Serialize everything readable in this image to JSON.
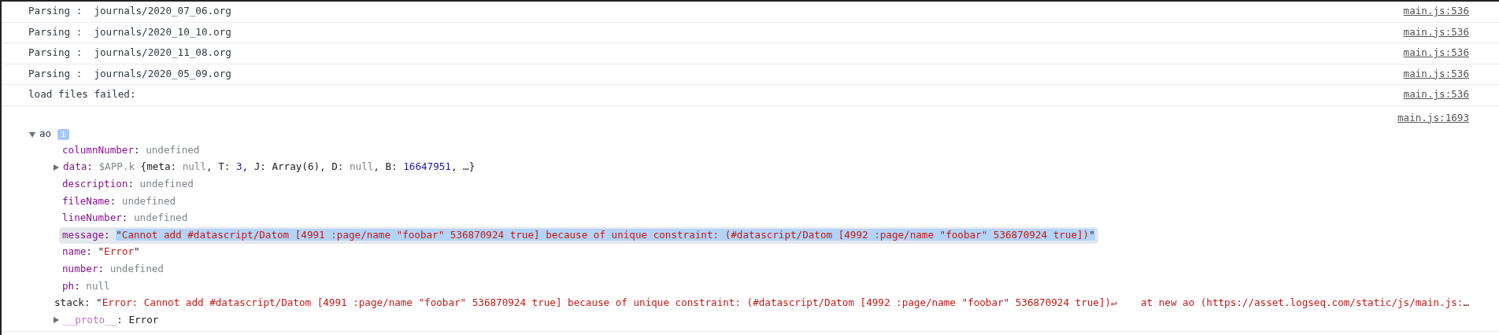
{
  "messages": [
    {
      "text": "Parsing :  journals/2020_07_06.org",
      "source": "main.js:536"
    },
    {
      "text": "Parsing :  journals/2020_10_10.org",
      "source": "main.js:536"
    },
    {
      "text": "Parsing :  journals/2020_11_08.org",
      "source": "main.js:536"
    },
    {
      "text": "Parsing :  journals/2020_05_09.org",
      "source": "main.js:536"
    },
    {
      "text": "load files failed:",
      "source": "main.js:536"
    }
  ],
  "object": {
    "source": "main.js:1693",
    "name": "ao",
    "expanded": true,
    "badge": "i",
    "properties": [
      {
        "name": "columnNumber",
        "separator": ": ",
        "kind": "own",
        "value": [
          {
            "text": "undefined",
            "kind": "null"
          }
        ]
      },
      {
        "name": "data",
        "separator": ": ",
        "kind": "own",
        "expanded": false,
        "value": [
          {
            "text": "$APP.k ",
            "kind": "class"
          },
          {
            "text": "{meta: ",
            "kind": "plain"
          },
          {
            "text": "null",
            "kind": "null"
          },
          {
            "text": ", T: ",
            "kind": "plain"
          },
          {
            "text": "3",
            "kind": "number"
          },
          {
            "text": ", J: Array(6), D: ",
            "kind": "plain"
          },
          {
            "text": "null",
            "kind": "null"
          },
          {
            "text": ", B: ",
            "kind": "plain"
          },
          {
            "text": "16647951",
            "kind": "number"
          },
          {
            "text": ", …}",
            "kind": "plain"
          }
        ]
      },
      {
        "name": "description",
        "separator": ": ",
        "kind": "own",
        "value": [
          {
            "text": "undefined",
            "kind": "null"
          }
        ]
      },
      {
        "name": "fileName",
        "separator": ": ",
        "kind": "own",
        "value": [
          {
            "text": "undefined",
            "kind": "null"
          }
        ]
      },
      {
        "name": "lineNumber",
        "separator": ": ",
        "kind": "own",
        "value": [
          {
            "text": "undefined",
            "kind": "null"
          }
        ]
      },
      {
        "name": "message",
        "separator": ": ",
        "kind": "own",
        "highlighted": true,
        "value": [
          {
            "text": "\"",
            "kind": "plain"
          },
          {
            "text": "Cannot add #datascript/Datom [4991 :page/name \"foobar\" 536870924 true] because of unique constraint: (#datascript/Datom [4992 :page/name \"foobar\" 536870924 true])",
            "kind": "string"
          },
          {
            "text": "\"",
            "kind": "plain"
          }
        ]
      },
      {
        "name": "name",
        "separator": ": ",
        "kind": "own",
        "value": [
          {
            "text": "\"",
            "kind": "plain"
          },
          {
            "text": "Error",
            "kind": "string"
          },
          {
            "text": "\"",
            "kind": "plain"
          }
        ]
      },
      {
        "name": "number",
        "separator": ": ",
        "kind": "own",
        "value": [
          {
            "text": "undefined",
            "kind": "null"
          }
        ]
      },
      {
        "name": "ph",
        "separator": ": ",
        "kind": "own",
        "value": [
          {
            "text": "null",
            "kind": "null"
          }
        ]
      },
      {
        "name": "stack",
        "separator": ": ",
        "kind": "plain",
        "value": [
          {
            "text": "\"",
            "kind": "plain"
          },
          {
            "text": "Error: Cannot add #datascript/Datom [4991 :page/name \"foobar\" 536870924 true] because of unique constraint: (#datascript/Datom [4992 :page/name \"foobar\" 536870924 true])↵    at new ao (https://asset.logseq.com/static/js/main.js:",
            "kind": "string"
          },
          {
            "text": "…",
            "kind": "plain"
          }
        ]
      },
      {
        "name": "__proto__",
        "separator": ": ",
        "kind": "internal",
        "expanded": false,
        "value": [
          {
            "text": "Error",
            "kind": "plain"
          }
        ]
      }
    ]
  }
}
